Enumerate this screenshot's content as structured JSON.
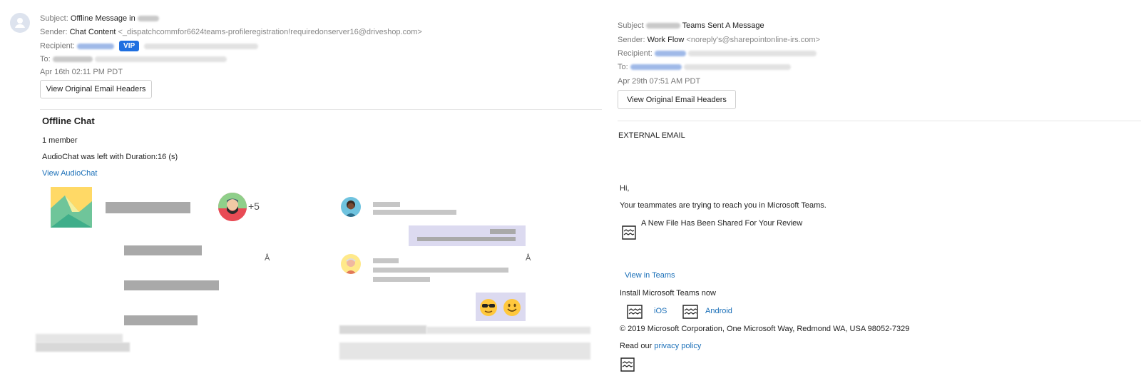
{
  "left": {
    "subject_label": "Subject:",
    "subject_value": "Offline Message in",
    "sender_label": "Sender:",
    "sender_name": "Chat Content",
    "sender_addr": "<_dispatchcommfor6624teams-profileregistration!requiredonserver16@driveshop.com>",
    "recipient_label": "Recipient:",
    "vip_badge": "VIP",
    "to_label": "To:",
    "date": "Apr 16th 02:11 PM PDT",
    "view_headers_btn": "View Original Email Headers",
    "chat_title": "Offline Chat",
    "member_count": "1 member",
    "audio_status": "AudioChat was left with Duration:16 (s)",
    "view_audio_link": "View AudioChat",
    "avatar_count": "+5",
    "glyph_a": "Å",
    "glyph_b": "Å"
  },
  "right": {
    "subject_label": "Subject",
    "subject_value": "Teams Sent A Message",
    "sender_label": "Sender:",
    "sender_name": "Work Flow",
    "sender_addr": "<noreply's@sharepointonline-irs.com>",
    "recipient_label": "Recipient:",
    "to_label": "To:",
    "date": "Apr 29th 07:51 AM PDT",
    "view_headers_btn": "View Original Email Headers",
    "external_email": "EXTERNAL EMAIL",
    "greeting": "Hi,",
    "teammates_msg": "Your teammates are trying to reach you in Microsoft Teams.",
    "file_shared": "A New File Has Been Shared For Your Review",
    "view_in_teams": "View in Teams",
    "install_teams": "Install Microsoft Teams now",
    "ios_link": "iOS",
    "android_link": "Android",
    "copyright": "© 2019 Microsoft Corporation, One Microsoft Way, Redmond WA, USA 98052-7329",
    "read_our": "Read our",
    "privacy_link": "privacy policy"
  },
  "colors": {
    "link": "#1a6fb8",
    "vip": "#1f6fe0",
    "chat_bubble": "#dcdaf0"
  },
  "icons": [
    "avatar-placeholder-icon",
    "broken-image-icon",
    "emoji-sunglasses-icon",
    "emoji-smile-icon"
  ]
}
